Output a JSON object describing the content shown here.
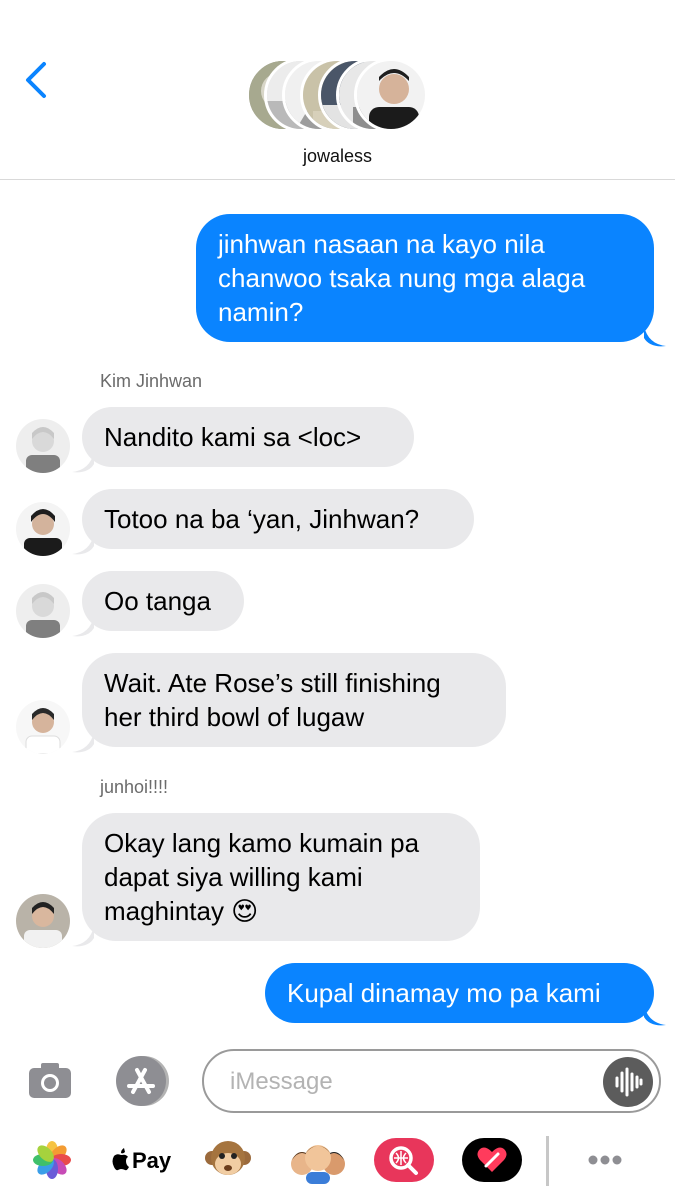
{
  "header": {
    "group_name": "jowaless",
    "back_icon": "chevron-left-icon",
    "accent": "#0a84ff"
  },
  "messages": {
    "m1": {
      "direction": "outgoing",
      "text": "jinhwan nasaan na kayo nila chanwoo tsaka nung mga alaga namin?"
    },
    "sender1": "Kim Jinhwan",
    "m2": {
      "direction": "incoming",
      "text": "Nandito kami sa <loc>"
    },
    "m3": {
      "direction": "incoming",
      "text": "Totoo na ba ‘yan, Jinhwan?"
    },
    "m4": {
      "direction": "incoming",
      "text": "Oo tanga"
    },
    "m5": {
      "direction": "incoming",
      "text": "Wait. Ate Rose’s still finishing her third bowl of lugaw"
    },
    "sender2": "junhoi!!!!",
    "m6": {
      "direction": "incoming",
      "text": "Okay lang kamo kumain pa dapat siya willing kami maghintay 😍"
    },
    "m7": {
      "direction": "outgoing",
      "text": "Kupal dinamay mo pa kami"
    }
  },
  "composer": {
    "placeholder": "iMessage",
    "camera_icon": "camera-icon",
    "appstore_icon": "app-store-icon",
    "audio_icon": "waveform-icon"
  },
  "drawer": {
    "photos_icon": "photos-icon",
    "apple_pay_label": "Pay",
    "animoji_icon": "monkey-animoji-icon",
    "memoji_icon": "memoji-stickers-icon",
    "search_icon": "image-search-icon",
    "digital_touch_icon": "digital-touch-icon",
    "more_icon": "more-icon"
  },
  "colors": {
    "outgoing_bubble": "#0a84ff",
    "incoming_bubble": "#e9e9eb"
  }
}
